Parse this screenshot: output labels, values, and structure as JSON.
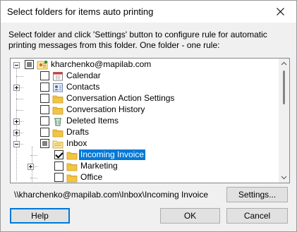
{
  "window": {
    "title": "Select folders for items auto printing"
  },
  "description": "Select folder and click 'Settings' button to configure rule for automatic printing messages from this folder. One folder - one rule:",
  "tree": {
    "items": [
      {
        "label": "kharchenko@mapilab.com",
        "level": 0,
        "expander": "minus",
        "check": "grey",
        "icon": "account-icon"
      },
      {
        "label": "Calendar",
        "level": 1,
        "expander": "none",
        "check": "empty",
        "icon": "calendar-icon"
      },
      {
        "label": "Contacts",
        "level": 1,
        "expander": "plus",
        "check": "empty",
        "icon": "contacts-icon"
      },
      {
        "label": "Conversation Action Settings",
        "level": 1,
        "expander": "none",
        "check": "empty",
        "icon": "folder-icon"
      },
      {
        "label": "Conversation History",
        "level": 1,
        "expander": "none",
        "check": "empty",
        "icon": "folder-icon"
      },
      {
        "label": "Deleted Items",
        "level": 1,
        "expander": "plus",
        "check": "empty",
        "icon": "trash-icon"
      },
      {
        "label": "Drafts",
        "level": 1,
        "expander": "plus",
        "check": "empty",
        "icon": "folder-icon"
      },
      {
        "label": "Inbox",
        "level": 1,
        "expander": "minus",
        "check": "grey",
        "icon": "inbox-icon"
      },
      {
        "label": "Incoming Invoice",
        "level": 2,
        "expander": "none",
        "check": "checked",
        "icon": "folder-icon",
        "selected": true
      },
      {
        "label": "Marketing",
        "level": 2,
        "expander": "plus",
        "check": "empty",
        "icon": "folder-icon"
      },
      {
        "label": "Office",
        "level": 2,
        "expander": "none",
        "check": "empty",
        "icon": "folder-icon"
      }
    ]
  },
  "path": "\\\\kharchenko@mapilab.com\\Inbox\\Incoming Invoice",
  "buttons": {
    "settings": "Settings...",
    "help": "Help",
    "ok": "OK",
    "cancel": "Cancel"
  },
  "colors": {
    "selection": "#0078d7",
    "folder": "#f5c542"
  }
}
